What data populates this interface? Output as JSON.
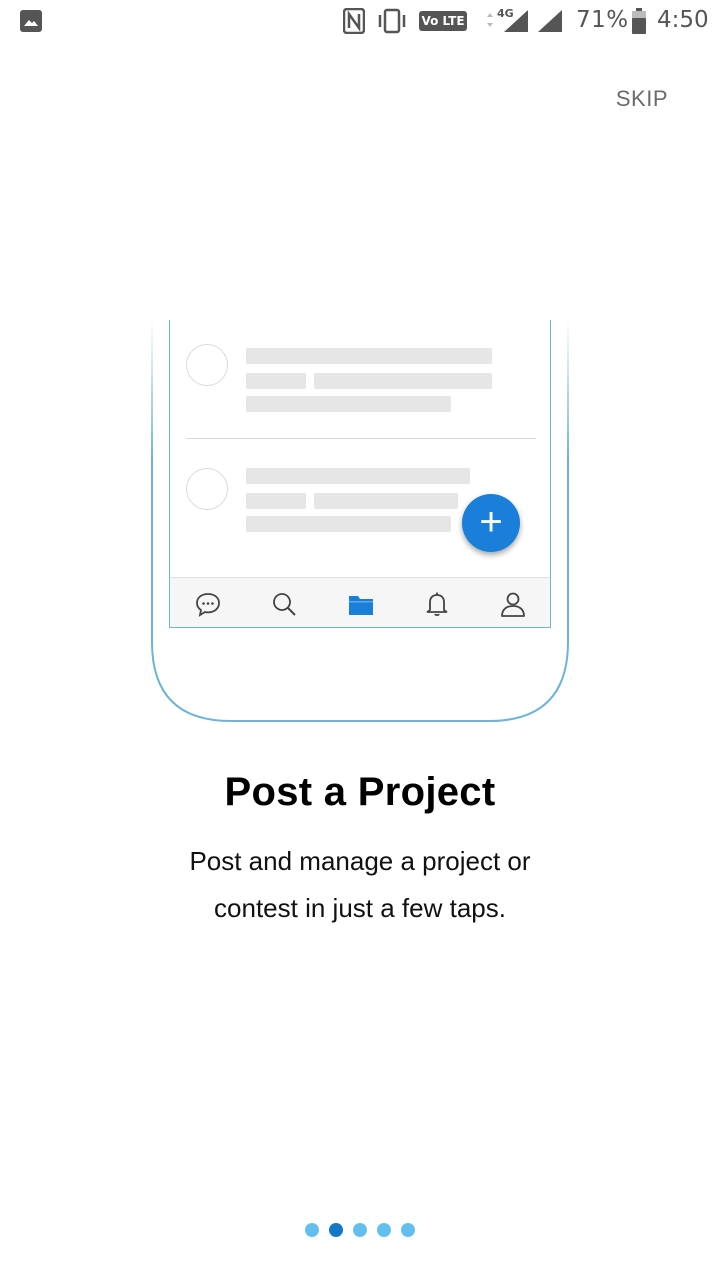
{
  "status_bar": {
    "network_label": "4G",
    "volte_label": "Vo LTE",
    "battery_percent": "71%",
    "time": "4:50"
  },
  "skip_label": "SKIP",
  "illustration": {
    "nav_icons": [
      "chat-icon",
      "search-icon",
      "folder-icon",
      "bell-icon",
      "profile-icon"
    ],
    "active_nav": "folder-icon",
    "fab_symbol": "+"
  },
  "onboarding": {
    "title": "Post a Project",
    "description": "Post and manage a project or contest in just a few taps."
  },
  "pager": {
    "total": 5,
    "current_index": 1
  },
  "colors": {
    "accent": "#1a7fd8",
    "dot_inactive": "#63c0ee",
    "dot_active": "#1578c8",
    "phone_outline": "#6fb3d9"
  }
}
